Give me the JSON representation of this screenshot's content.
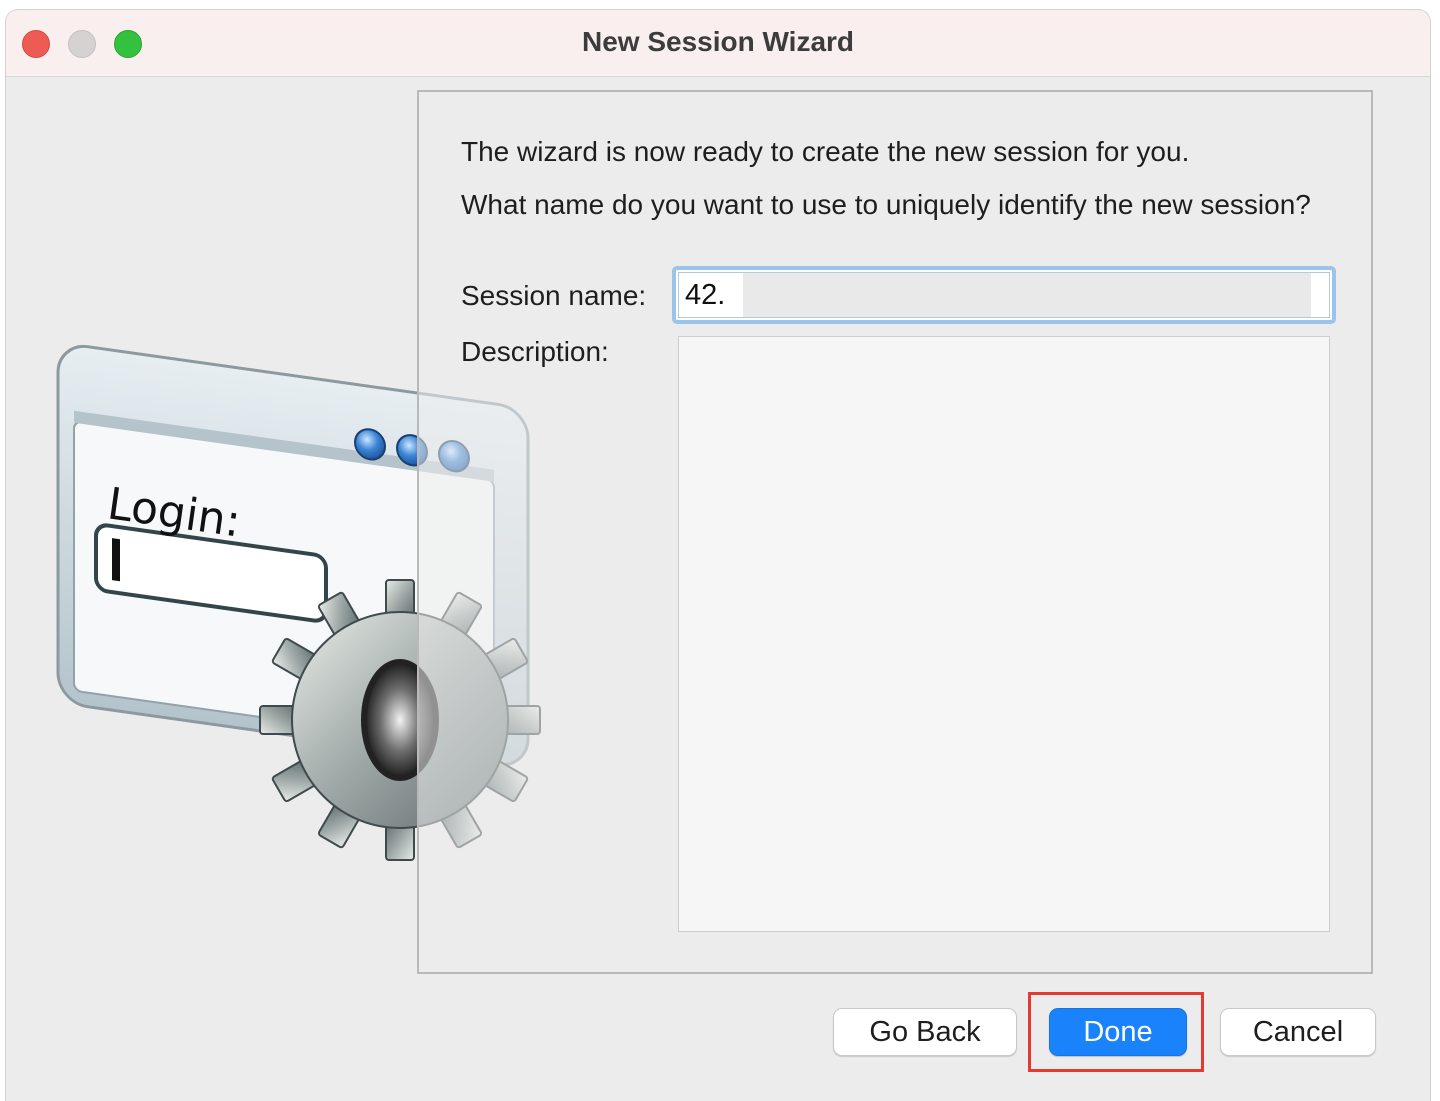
{
  "window": {
    "title": "New Session Wizard"
  },
  "illustration": {
    "login_label": "Login:",
    "icon": "login-window-with-gear"
  },
  "content": {
    "intro": "The wizard is now ready to create the new session for you.",
    "question": "What name do you want to use to uniquely identify the new session?",
    "session_name_label": "Session name:",
    "session_name_value": "42.",
    "description_label": "Description:",
    "description_value": ""
  },
  "buttons": {
    "go_back": "Go Back",
    "done": "Done",
    "cancel": "Cancel"
  },
  "colors": {
    "primary_button": "#1a82fb",
    "highlight_box": "#e33a32",
    "focus_ring": "#9cc3ea"
  }
}
